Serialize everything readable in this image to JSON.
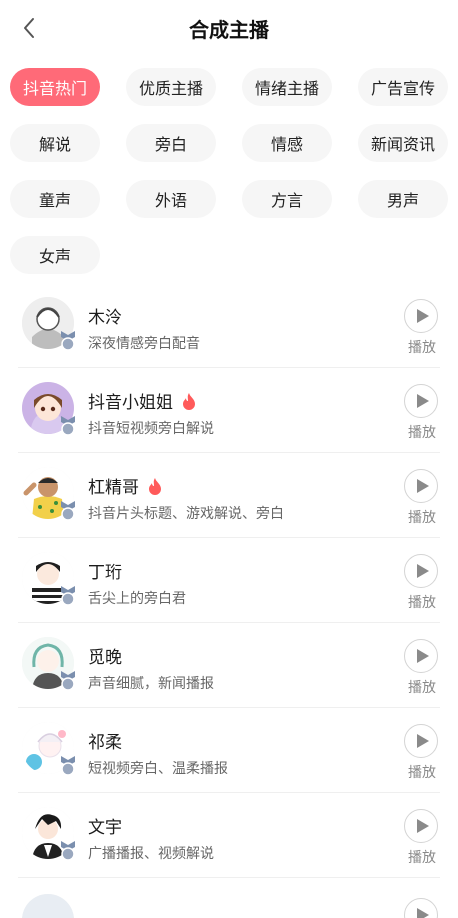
{
  "header": {
    "title": "合成主播",
    "back_icon": "chevron-left-icon"
  },
  "categories": [
    {
      "label": "抖音热门",
      "active": true
    },
    {
      "label": "优质主播",
      "active": false
    },
    {
      "label": "情绪主播",
      "active": false
    },
    {
      "label": "广告宣传",
      "active": false
    },
    {
      "label": "解说",
      "active": false
    },
    {
      "label": "旁白",
      "active": false
    },
    {
      "label": "情感",
      "active": false
    },
    {
      "label": "新闻资讯",
      "active": false
    },
    {
      "label": "童声",
      "active": false
    },
    {
      "label": "外语",
      "active": false
    },
    {
      "label": "方言",
      "active": false
    },
    {
      "label": "男声",
      "active": false
    },
    {
      "label": "女声",
      "active": false
    }
  ],
  "colors": {
    "accent": "#ff6a78",
    "flame": "#ff5a5a",
    "medal": "#7b8fae"
  },
  "anchors": [
    {
      "name": "木泠",
      "desc": "深夜情感旁白配音",
      "hot": false,
      "play_label": "播放"
    },
    {
      "name": "抖音小姐姐",
      "desc": "抖音短视频旁白解说",
      "hot": true,
      "play_label": "播放"
    },
    {
      "name": "杠精哥",
      "desc": "抖音片头标题、游戏解说、旁白",
      "hot": true,
      "play_label": "播放"
    },
    {
      "name": "丁珩",
      "desc": "舌尖上的旁白君",
      "hot": false,
      "play_label": "播放"
    },
    {
      "name": "觅晚",
      "desc": "声音细腻，新闻播报",
      "hot": false,
      "play_label": "播放"
    },
    {
      "name": "祁柔",
      "desc": "短视频旁白、温柔播报",
      "hot": false,
      "play_label": "播放"
    },
    {
      "name": "文宇",
      "desc": "广播播报、视频解说",
      "hot": false,
      "play_label": "播放"
    }
  ]
}
